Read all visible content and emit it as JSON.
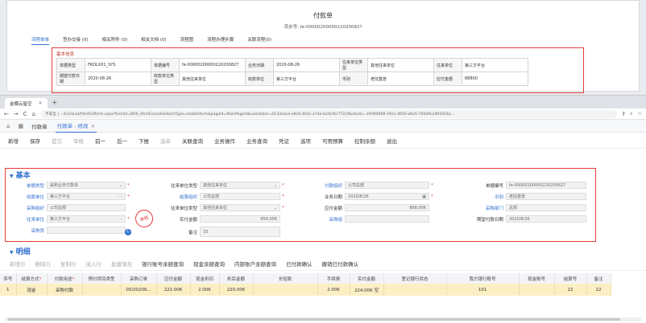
{
  "background_doc": {
    "title": "付款单",
    "serial": "流水号: fe-0000020000022020082?",
    "tabs": [
      "流程单单",
      "签办交接 (0)",
      "相关附件 (0)",
      "相关文档 (0)",
      "流程图",
      "流程办理步骤",
      "关联流程(0)"
    ],
    "section": "基本信息",
    "rows": [
      [
        "单据类型",
        "FKDLX01_SYS",
        "单据编号",
        "fe-00000200000220200827",
        "业务日期",
        "2020-08-26",
        "往来单位类型",
        "其他往来单位",
        "往来单位",
        "第三方平台"
      ],
      [
        "期望付款日期",
        "2020-08-26",
        "收款单位类型",
        "其他往来单位",
        "收款单位",
        "第三方平台",
        "币别",
        "老挝基普",
        "应付金额",
        "88800"
      ]
    ]
  },
  "browser": {
    "tab_title": "金蝶云星空",
    "url": "不安全 | ···/k3cloud/html5/dform.aspx?formId=BOS_HtmlConsole&formType=mobileform&pageId=MainPageId&usertoken=0c33aaca-e8e5-402c-a74e-b24cf4c772c0&skuId=-29d94948-19e1-4659-a6e5-706d9ca90202&c..."
  },
  "app_tabs": {
    "home": "付款单",
    "active": "付款单 - 修改"
  },
  "toolbar": [
    "新增",
    "保存",
    "提交",
    "审核",
    "前一",
    "后一",
    "下推",
    "选单",
    "关联查询",
    "业务操作",
    "业务查询",
    "凭证",
    "选项",
    "可用预算",
    "控制余额",
    "退出"
  ],
  "toolbar_dim": [
    2,
    3,
    7
  ],
  "section_basic": "基本",
  "form": {
    "djlx": {
      "label": "单据类型",
      "value": "采购业务付款单"
    },
    "wldwlx": {
      "label": "往来单位类型",
      "value": "其他往来单位"
    },
    "fkzz": {
      "label": "付款组织",
      "value": "公司总部"
    },
    "djbh": {
      "label": "单据编号",
      "value": "fe-00000200000220200827"
    },
    "skdw": {
      "label": "收款单位",
      "value": "第三方平台"
    },
    "jszz": {
      "label": "结算组织",
      "value": "公司总部"
    },
    "ywrq": {
      "label": "业务日期",
      "value": "2020/8/26"
    },
    "bb": {
      "label": "币别",
      "value": "老挝基普"
    },
    "cgzz": {
      "label": "采购组织",
      "value": "公司总部"
    },
    "skdwlx": {
      "label": "往来单位类型",
      "value": "其他往来单位"
    },
    "yfje": {
      "label": "应付金额",
      "value": "888.00K"
    },
    "cgbm": {
      "label": "采购部门",
      "value": "总部"
    },
    "wldw": {
      "label": "往来单位",
      "value": "第三方平台"
    },
    "sfje": {
      "label": "实付金额",
      "value": "956.00K"
    },
    "cgz": {
      "label": "采购组",
      "value": ""
    },
    "qwfkrq": {
      "label": "期望付款日期",
      "value": "2020/8/26"
    },
    "cgy": {
      "label": "采购员",
      "value": ""
    },
    "bz": {
      "label": "备注",
      "value": "33"
    },
    "stamp": "审核"
  },
  "section_detail": "明细",
  "detail_bar": [
    "新增行",
    "删除行",
    "复制行",
    "插入行",
    "批量填充",
    "银行账号余额查询",
    "现金余额查询",
    "内部账户余额查询",
    "已付款确认",
    "撤销已付款确认"
  ],
  "detail_dim": [
    0,
    1,
    2,
    3,
    4
  ],
  "grid": {
    "headers": [
      "序号",
      "结算方式",
      "付款用途",
      "预付项目类型",
      "采购订单",
      "应付金额",
      "现金折扣",
      "折后金额",
      "长短款",
      "手续费",
      "实付金额",
      "登记银行状态",
      "我方银行账号",
      "现金账号",
      "结算号",
      "备注"
    ],
    "required": [
      1,
      2
    ],
    "row": [
      "1",
      "现金",
      "采购付款",
      "",
      "DD20200...",
      "222.00K",
      "2.00K",
      "220.00K",
      "",
      "2.00K",
      "224.00K 空",
      "",
      "101",
      "",
      "22",
      "22"
    ]
  }
}
